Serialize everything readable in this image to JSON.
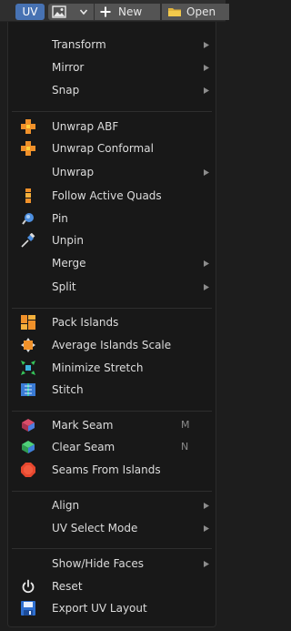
{
  "header": {
    "mode_label": "UV",
    "new_label": "New",
    "open_label": "Open",
    "accent_color": "#4772b3"
  },
  "menu": {
    "items": [
      {
        "label": "Transform",
        "submenu": true
      },
      {
        "label": "Mirror",
        "submenu": true
      },
      {
        "label": "Snap",
        "submenu": true
      },
      {
        "label": "Unwrap ABF",
        "icon": "unwrap-abf-icon"
      },
      {
        "label": "Unwrap Conformal",
        "icon": "unwrap-conformal-icon"
      },
      {
        "label": "Unwrap",
        "submenu": true
      },
      {
        "label": "Follow Active Quads",
        "icon": "follow-active-quads-icon"
      },
      {
        "label": "Pin",
        "icon": "pin-icon"
      },
      {
        "label": "Unpin",
        "icon": "unpin-icon"
      },
      {
        "label": "Merge",
        "submenu": true
      },
      {
        "label": "Split",
        "submenu": true
      },
      {
        "label": "Pack Islands",
        "icon": "pack-islands-icon"
      },
      {
        "label": "Average Islands Scale",
        "icon": "average-islands-scale-icon"
      },
      {
        "label": "Minimize Stretch",
        "icon": "minimize-stretch-icon"
      },
      {
        "label": "Stitch",
        "icon": "stitch-icon"
      },
      {
        "label": "Mark Seam",
        "icon": "mark-seam-icon",
        "shortcut": "M"
      },
      {
        "label": "Clear Seam",
        "icon": "clear-seam-icon",
        "shortcut": "N"
      },
      {
        "label": "Seams From Islands",
        "icon": "seams-from-islands-icon"
      },
      {
        "label": "Align",
        "submenu": true
      },
      {
        "label": "UV Select Mode",
        "submenu": true
      },
      {
        "label": "Show/Hide Faces",
        "submenu": true
      },
      {
        "label": "Reset",
        "icon": "power-icon"
      },
      {
        "label": "Export UV Layout",
        "icon": "export-uv-layout-icon"
      }
    ]
  }
}
